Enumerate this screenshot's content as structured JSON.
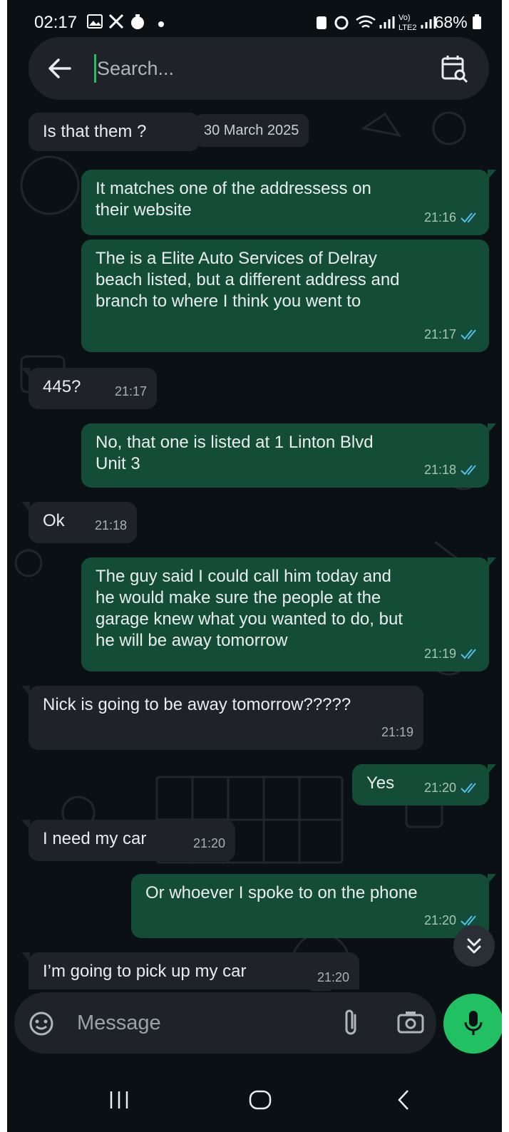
{
  "status_bar": {
    "time": "02:17",
    "battery": "68%",
    "lte_label": "Vo) LTE2"
  },
  "search": {
    "placeholder": "Search..."
  },
  "date_chip": "30 March 2025",
  "messages": [
    {
      "dir": "in",
      "text": "Is that them ?",
      "time": ""
    },
    {
      "dir": "out",
      "text": "It matches one of the addressess on\ntheir website",
      "time": "21:16"
    },
    {
      "dir": "out",
      "text": "The is a Elite Auto Services of Delray\nbeach listed, but a different address and\nbranch to where I think you went to",
      "time": "21:17"
    },
    {
      "dir": "in",
      "text": "445?",
      "time": "21:17"
    },
    {
      "dir": "out",
      "text": "No, that one is listed at 1 Linton Blvd\nUnit 3",
      "time": "21:18"
    },
    {
      "dir": "in",
      "text": "Ok",
      "time": "21:18"
    },
    {
      "dir": "out",
      "text": "The guy said I could call him today and\nhe would make sure the people at the\ngarage knew what you wanted to do, but\nhe will be away tomorrow",
      "time": "21:19"
    },
    {
      "dir": "in",
      "text": "Nick is going to be away tomorrow?????",
      "time": "21:19"
    },
    {
      "dir": "out",
      "text": "Yes",
      "time": "21:20"
    },
    {
      "dir": "in",
      "text": "I need my car",
      "time": "21:20"
    },
    {
      "dir": "out",
      "text": "Or whoever I spoke to on the phone",
      "time": "21:20"
    },
    {
      "dir": "in",
      "text": "I’m going to pick up my car",
      "time": "21:20"
    }
  ],
  "composer": {
    "placeholder": "Message"
  },
  "colors": {
    "accent": "#21c063",
    "outgoing_bubble": "#134d37",
    "incoming_bubble": "#1f2329",
    "read_tick": "#53bdeb"
  },
  "icons": [
    "back-arrow-icon",
    "calendar-search-icon",
    "sticker-icon",
    "attach-icon",
    "camera-icon",
    "mic-icon",
    "scroll-down-icon",
    "nav-recents-icon",
    "nav-home-icon",
    "nav-back-icon"
  ]
}
